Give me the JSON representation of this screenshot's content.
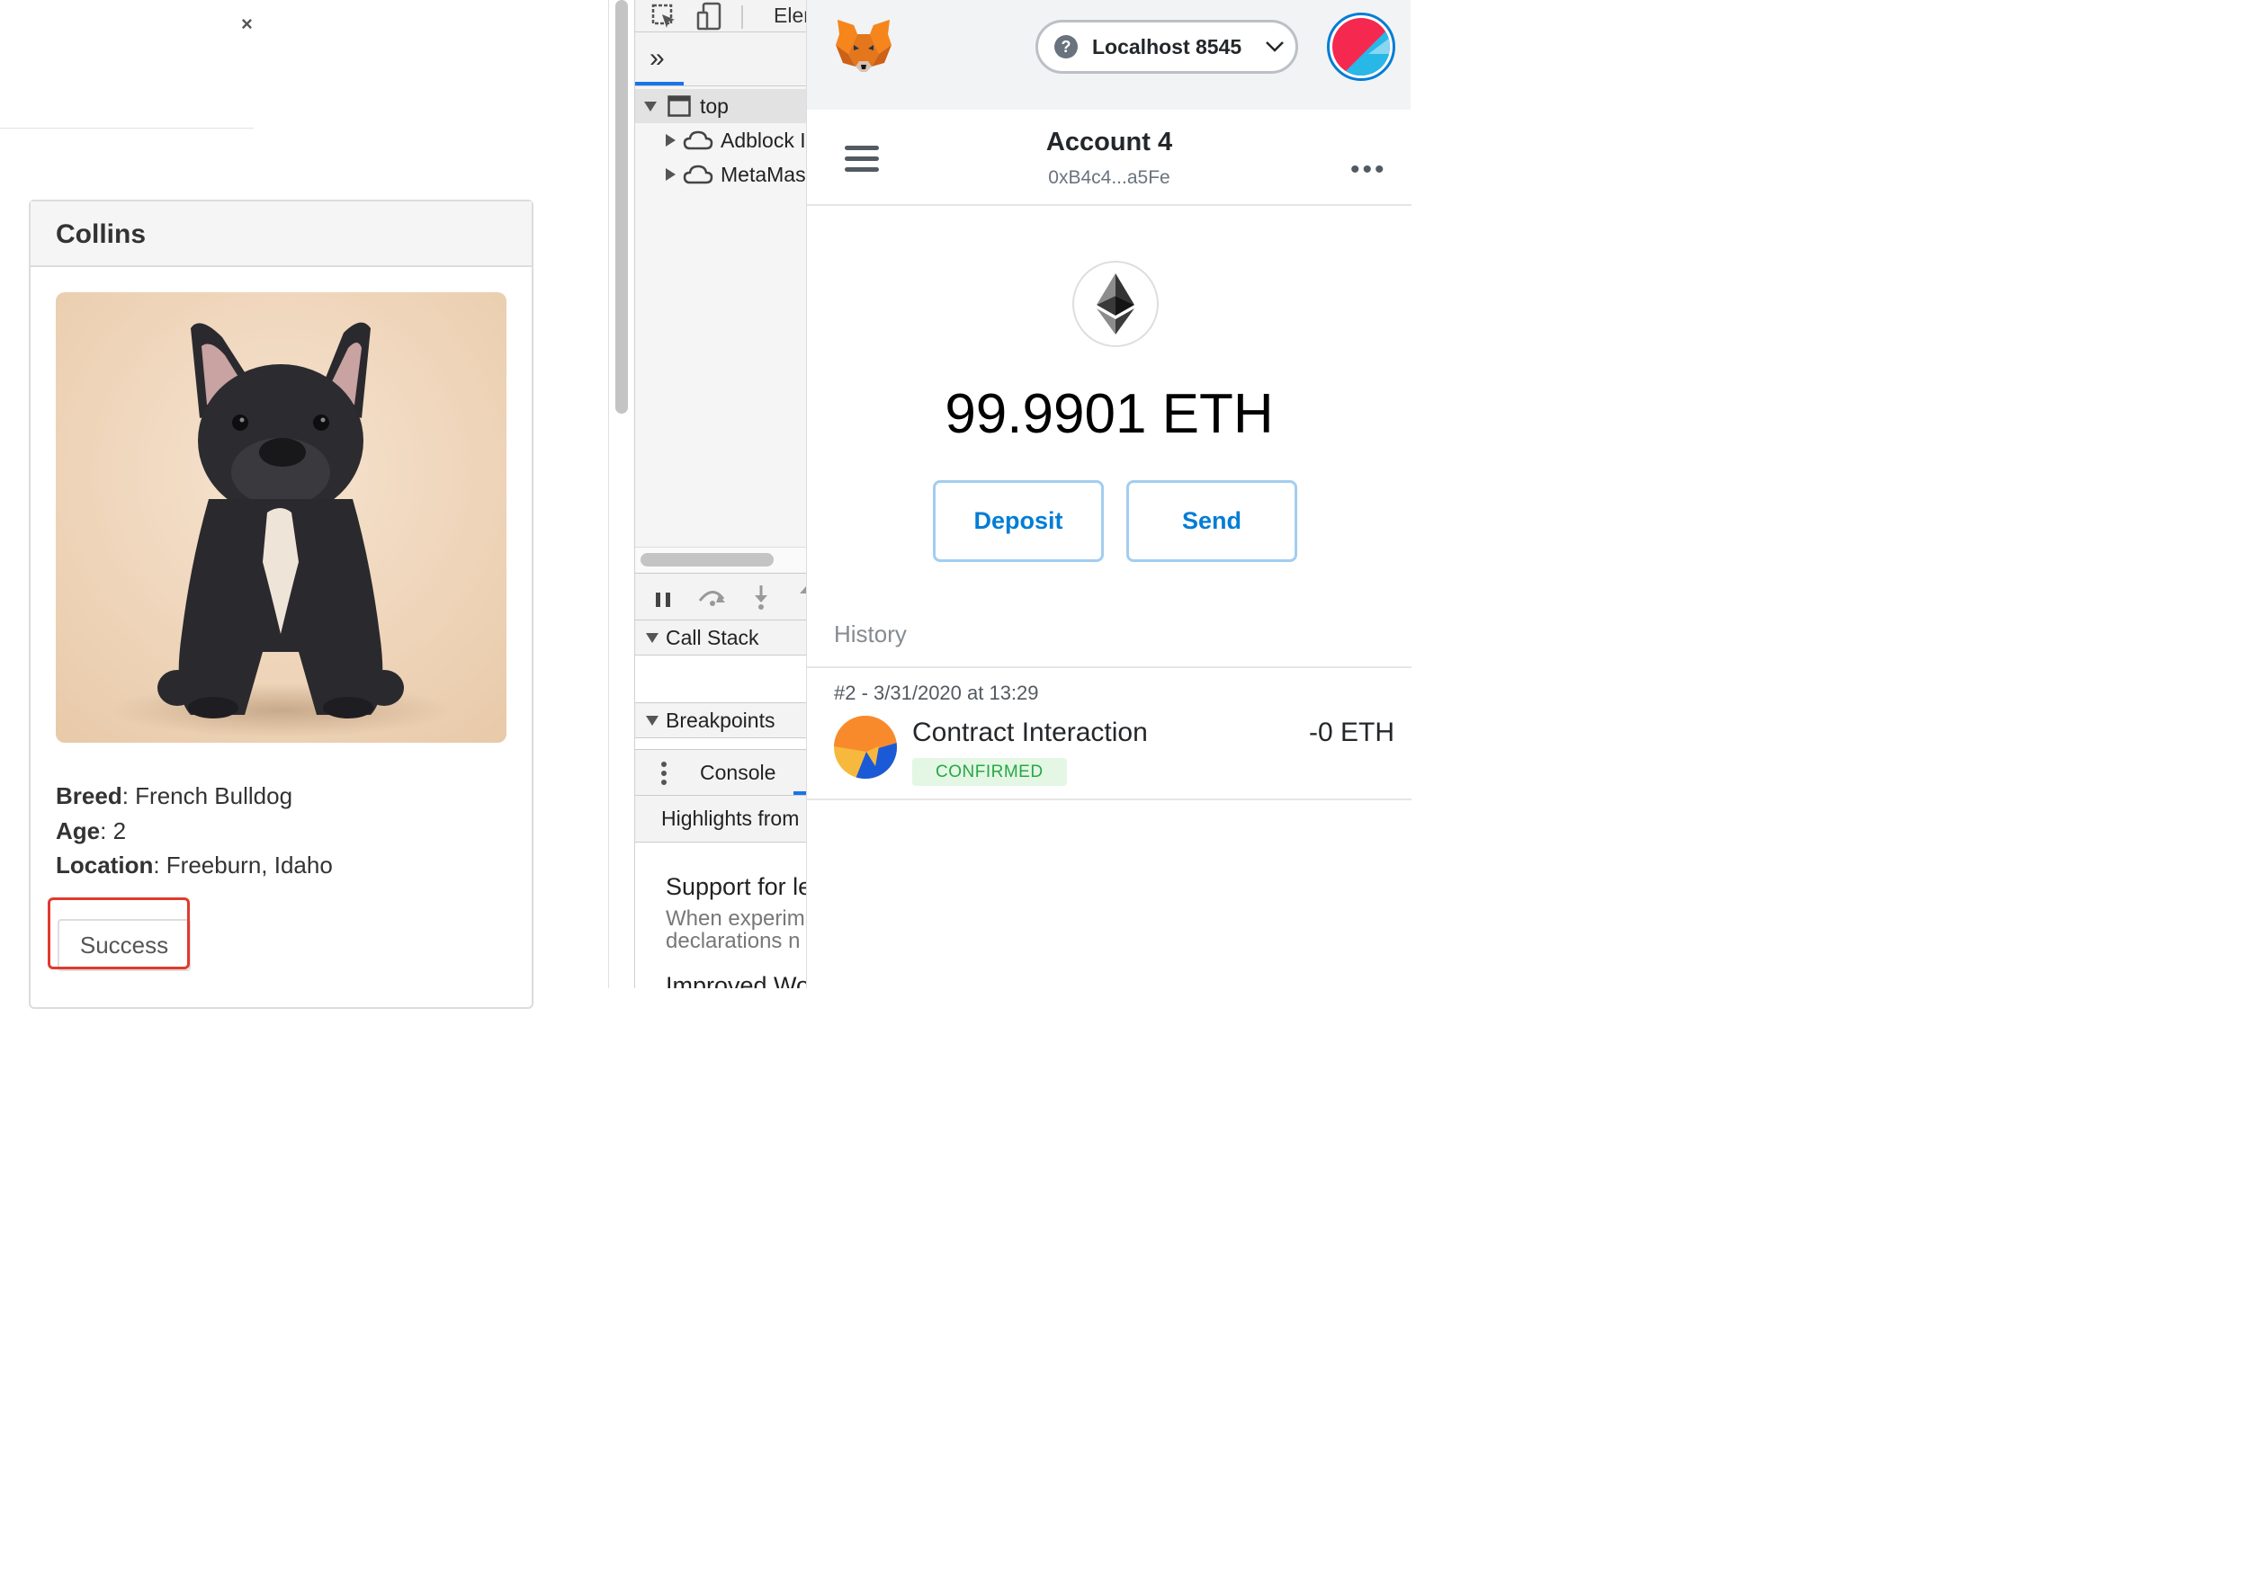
{
  "dapp": {
    "close_label": "×",
    "pet": {
      "name": "Collins",
      "breed_label": "Breed",
      "breed": "French Bulldog",
      "age_label": "Age",
      "age": "2",
      "location_label": "Location",
      "location": "Freeburn, Idaho",
      "adopt_button": "Success"
    }
  },
  "devtools": {
    "toolbar_tab": "Elen",
    "more_tabs": "»",
    "frames": [
      {
        "label": "top"
      },
      {
        "label": "Adblock I"
      },
      {
        "label": "MetaMas"
      }
    ],
    "sections": {
      "call_stack": "Call Stack",
      "breakpoints": "Breakpoints"
    },
    "console_tab": "Console",
    "highlights": "Highlights from",
    "article_title": "Support for le",
    "article_body_1": "When experim",
    "article_body_2": "declarations n",
    "article_next": "Improved Wo"
  },
  "metamask": {
    "network": "Localhost 8545",
    "account_name": "Account 4",
    "account_address": "0xB4c4...a5Fe",
    "balance": "99.9901 ETH",
    "deposit_button": "Deposit",
    "send_button": "Send",
    "history_label": "History",
    "transactions": [
      {
        "date": "#2 - 3/31/2020 at 13:29",
        "title": "Contract Interaction",
        "amount": "-0 ETH",
        "status": "CONFIRMED"
      }
    ],
    "colors": {
      "accent": "#037dd6",
      "confirmed": "#28a745"
    }
  }
}
